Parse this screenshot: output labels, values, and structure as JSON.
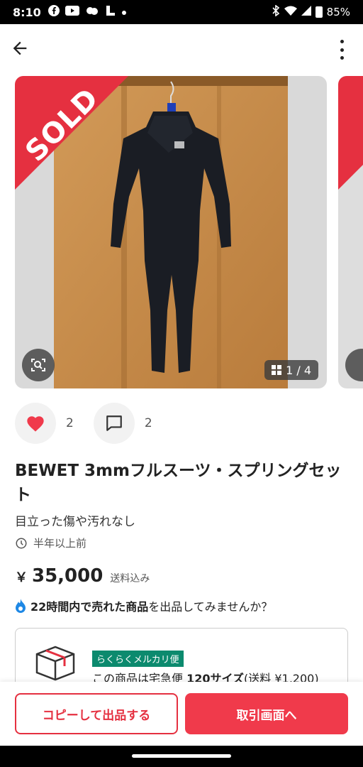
{
  "status_bar": {
    "time": "8:10",
    "battery": "85%",
    "icons": [
      "facebook-icon",
      "youtube-icon",
      "weather-icon",
      "notification-icon",
      "dot-icon",
      "bluetooth-icon",
      "wifi-icon",
      "signal-icon",
      "battery-icon"
    ]
  },
  "app_bar": {
    "back_icon": "arrow-left-icon",
    "more_icon": "more-vert-icon"
  },
  "gallery": {
    "sold_label": "SOLD",
    "counter": "1 / 4",
    "lens_icon": "image-search-icon"
  },
  "actions": {
    "likes": "2",
    "comments": "2"
  },
  "item": {
    "title": "BEWET 3mmフルスーツ・スプリングセット",
    "condition": "目立った傷や汚れなし",
    "posted": "半年以上前",
    "currency": "￥",
    "price": "35,000",
    "shipping_note": "送料込み"
  },
  "promo": {
    "bold": "22時間内で売れた商品",
    "rest": "を出品してみませんか？"
  },
  "shipping": {
    "badge": "らくらくメルカリ便",
    "prefix": "この商品は宅急便 ",
    "size": "120サイズ",
    "fee": "(送料 ¥1,200)"
  },
  "buttons": {
    "copy": "コピーして出品する",
    "trade": "取引画面へ"
  },
  "colors": {
    "accent": "#f03a4b",
    "rakuraku": "#0c8a6e"
  }
}
